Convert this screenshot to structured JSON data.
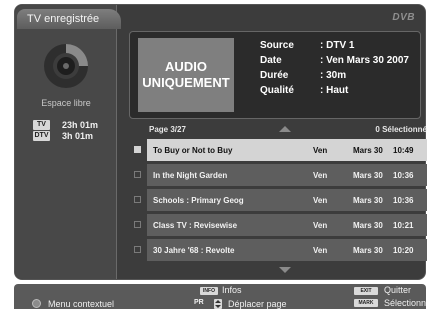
{
  "window": {
    "title": "TV enregistrée",
    "brand": "DVB"
  },
  "left_panel": {
    "free_space_label": "Espace libre",
    "tv_badge": "TV",
    "tv_time": "23h 01m",
    "dtv_badge": "DTV",
    "dtv_time": "3h 01m"
  },
  "info": {
    "preview_line1": "AUDIO",
    "preview_line2": "UNIQUEMENT",
    "source_label": "Source",
    "source_value": ": DTV 1",
    "date_label": "Date",
    "date_value": ": Ven Mars 30 2007",
    "duration_label": "Durée",
    "duration_value": ": 30m",
    "quality_label": "Qualité",
    "quality_value": ": Haut"
  },
  "list": {
    "page": "Page  3/27",
    "selected_count": "0 Sélectionné",
    "rows": [
      {
        "title": "To Buy or Not to Buy",
        "day": "Ven",
        "date": "Mars 30",
        "time": "10:49"
      },
      {
        "title": "In the Night Garden",
        "day": "Ven",
        "date": "Mars 30",
        "time": "10:36"
      },
      {
        "title": "Schools : Primary Geog",
        "day": "Ven",
        "date": "Mars 30",
        "time": "10:36"
      },
      {
        "title": "Class TV : Revisewise",
        "day": "Ven",
        "date": "Mars 30",
        "time": "10:21"
      },
      {
        "title": "30 Jahre '68 : Revolte",
        "day": "Ven",
        "date": "Mars 30",
        "time": "10:20"
      }
    ]
  },
  "help": {
    "context_menu": "Menu contextuel",
    "info_key": "INFO",
    "info_label": "Infos",
    "pr_key": "PR",
    "page_label": "Déplacer page",
    "exit_key": "EXIT",
    "exit_label": "Quitter",
    "mark_key": "MARK",
    "mark_label": "Sélectionner"
  },
  "colors": {
    "frame": "#3c3c3c",
    "selected_row": "#d4d4d4",
    "row": "#5e5e5e"
  }
}
